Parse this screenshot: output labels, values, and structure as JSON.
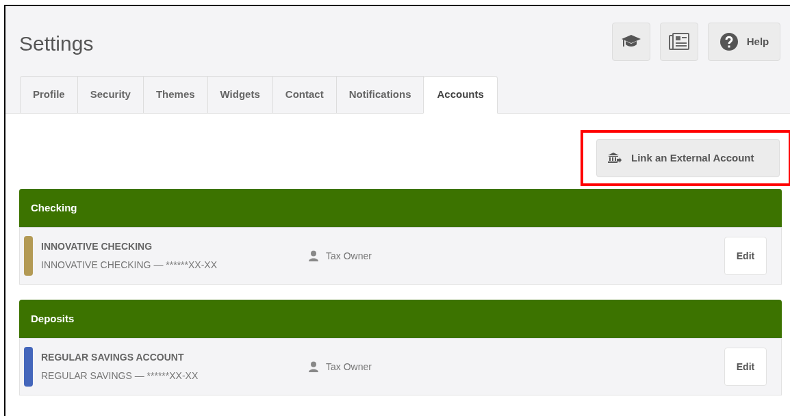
{
  "page": {
    "title": "Settings"
  },
  "header_buttons": [
    {
      "kind": "graduation"
    },
    {
      "kind": "newspaper"
    },
    {
      "kind": "help",
      "label": "Help"
    }
  ],
  "tabs": [
    {
      "label": "Profile",
      "selected": false
    },
    {
      "label": "Security",
      "selected": false
    },
    {
      "label": "Themes",
      "selected": false
    },
    {
      "label": "Widgets",
      "selected": false
    },
    {
      "label": "Contact",
      "selected": false
    },
    {
      "label": "Notifications",
      "selected": false
    },
    {
      "label": "Accounts",
      "selected": true
    }
  ],
  "link_button": {
    "label": "Link an External Account",
    "highlighted": true
  },
  "groups": [
    {
      "title": "Checking",
      "accounts": [
        {
          "name": "INNOVATIVE CHECKING",
          "detail": "INNOVATIVE CHECKING — ******XX-XX",
          "color": "#b39a55",
          "owner": "Tax Owner",
          "action": "Edit"
        }
      ]
    },
    {
      "title": "Deposits",
      "accounts": [
        {
          "name": "REGULAR SAVINGS ACCOUNT",
          "detail": "REGULAR SAVINGS — ******XX-XX",
          "color": "#4466bb",
          "owner": "Tax Owner",
          "action": "Edit"
        }
      ]
    }
  ]
}
